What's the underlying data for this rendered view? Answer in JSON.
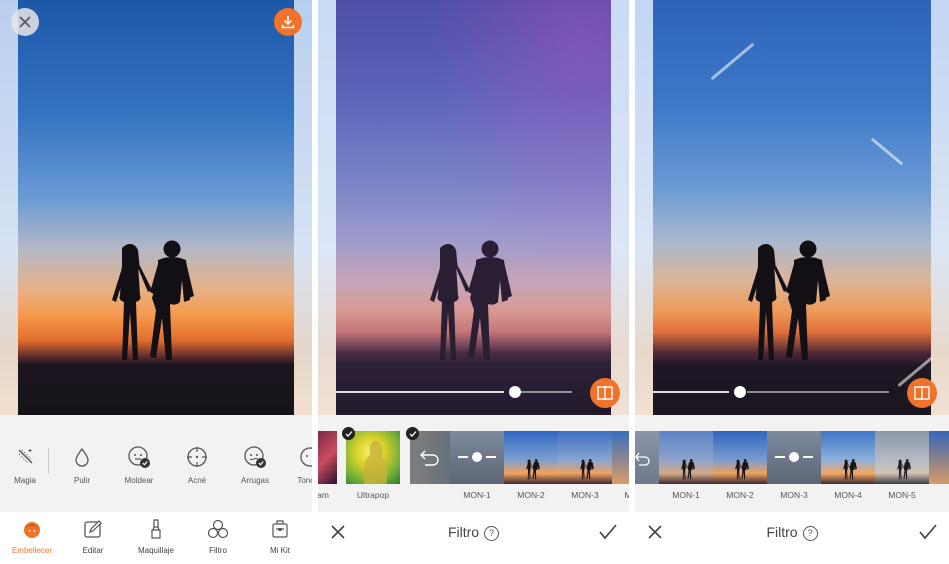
{
  "colors": {
    "accent": "#f0732b",
    "dark_text": "#444444",
    "light_bar": "#f2f2f2"
  },
  "panel1": {
    "top_icons": {
      "close": "close-icon",
      "download": "download-icon"
    },
    "tools": [
      {
        "label": "Magia",
        "icon": "magic-wand-icon"
      },
      {
        "label": "Pulir",
        "icon": "drop-icon"
      },
      {
        "label": "Moldear",
        "icon": "face-reshape-icon"
      },
      {
        "label": "Acné",
        "icon": "target-icon"
      },
      {
        "label": "Arrugas",
        "icon": "face-wrinkle-icon"
      },
      {
        "label": "Tono D",
        "icon": "face-tone-icon"
      }
    ],
    "nav": [
      {
        "label": "Embellecer",
        "icon": "beauty-face-icon",
        "active": true
      },
      {
        "label": "Editar",
        "icon": "edit-icon",
        "active": false
      },
      {
        "label": "Maquillaje",
        "icon": "brush-icon",
        "active": false
      },
      {
        "label": "Filtro",
        "icon": "filter-circles-icon",
        "active": false
      },
      {
        "label": "Mi Kit",
        "icon": "kit-box-icon",
        "active": false
      }
    ]
  },
  "panel2": {
    "slider_value": 0.9,
    "filters": [
      {
        "label": "am"
      },
      {
        "label": "Ultrapop"
      },
      {
        "label": "MON-1"
      },
      {
        "label": "MON-2"
      },
      {
        "label": "MON-3"
      },
      {
        "label": "M"
      }
    ],
    "bottom": {
      "title": "Filtro",
      "help": "?"
    }
  },
  "panel3": {
    "slider_value": 0.37,
    "filters": [
      {
        "label": "MON-1"
      },
      {
        "label": "MON-2"
      },
      {
        "label": "MON-3"
      },
      {
        "label": "MON-4"
      },
      {
        "label": "MON-5"
      }
    ],
    "bottom": {
      "title": "Filtro",
      "help": "?"
    }
  }
}
